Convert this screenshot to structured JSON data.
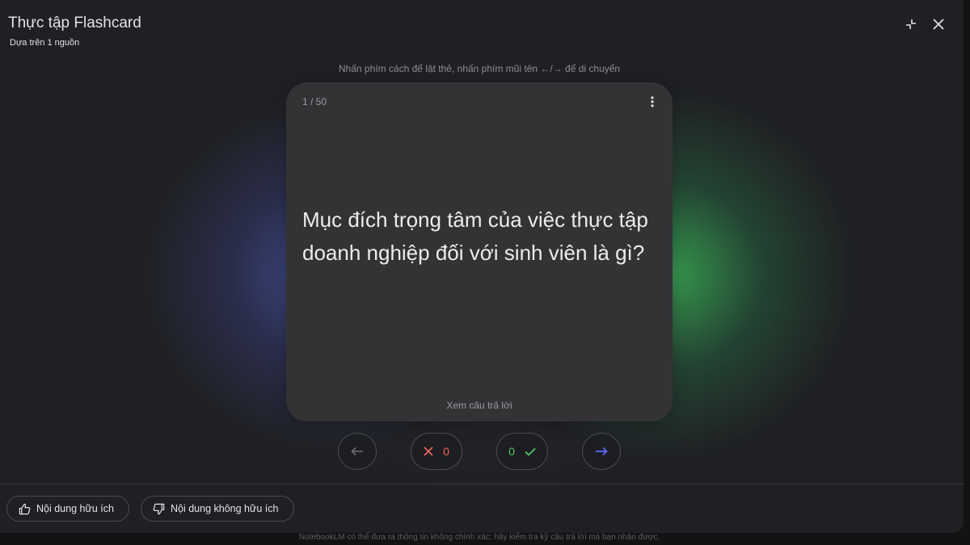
{
  "header": {
    "title": "Thực tập Flashcard",
    "subtitle": "Dựa trên 1 nguồn"
  },
  "hint": "Nhấn phím cách để lật thẻ, nhấn phím mũi tên ←/→ để di chuyển",
  "card": {
    "counter": "1 / 50",
    "question": "Mục đích trọng tâm của việc thực tập doanh nghiệp đối với sinh viên là gì?",
    "reveal_label": "Xem câu trả lời"
  },
  "controls": {
    "wrong_count": "0",
    "correct_count": "0"
  },
  "feedback": {
    "helpful_label": "Nội dung hữu ích",
    "not_helpful_label": "Nội dung không hữu ích"
  },
  "disclaimer": "NotebookLM có thể đưa ra thông tin không chính xác; hãy kiểm tra kỹ câu trả lời mà bạn nhận được.",
  "colors": {
    "wrong": "#f2665c",
    "correct": "#4cc96a",
    "next_arrow": "#5b6cff",
    "prev_arrow": "#6f7074"
  }
}
